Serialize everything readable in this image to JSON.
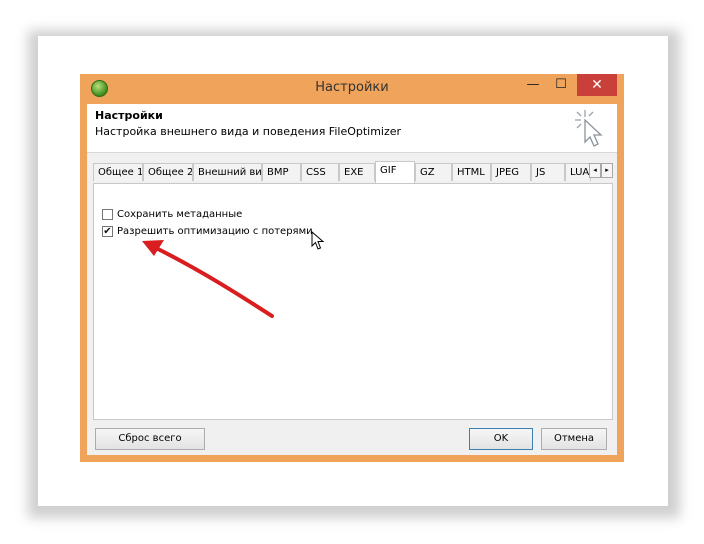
{
  "window": {
    "title": "Настройки",
    "min_glyph": "—",
    "max_glyph": "☐",
    "close_glyph": "✕"
  },
  "header": {
    "title": "Настройки",
    "description": "Настройка внешнего вида и поведения FileOptimizer"
  },
  "tabs": [
    {
      "label": "Общее 1"
    },
    {
      "label": "Общее 2"
    },
    {
      "label": "Внешний вид"
    },
    {
      "label": "BMP"
    },
    {
      "label": "CSS"
    },
    {
      "label": "EXE"
    },
    {
      "label": "GIF"
    },
    {
      "label": "GZ"
    },
    {
      "label": "HTML"
    },
    {
      "label": "JPEG"
    },
    {
      "label": "JS"
    },
    {
      "label": "LUA"
    }
  ],
  "active_tab": "GIF",
  "tab_scroll": {
    "left": "◂",
    "right": "▸"
  },
  "options": [
    {
      "label": "Сохранить метаданные",
      "checked": false,
      "mark": ""
    },
    {
      "label": "Разрешить оптимизацию с потерями",
      "checked": true,
      "mark": "✔"
    }
  ],
  "buttons": {
    "reset": "Сброс всего",
    "ok": "OK",
    "cancel": "Отмена"
  },
  "colors": {
    "window_frame": "#f0a35a",
    "close_button": "#c9403a",
    "annotation_arrow": "#d81e1e"
  },
  "icons": [
    "app-icon",
    "settings-cursor-icon",
    "mouse-cursor-icon",
    "annotation-arrow"
  ]
}
